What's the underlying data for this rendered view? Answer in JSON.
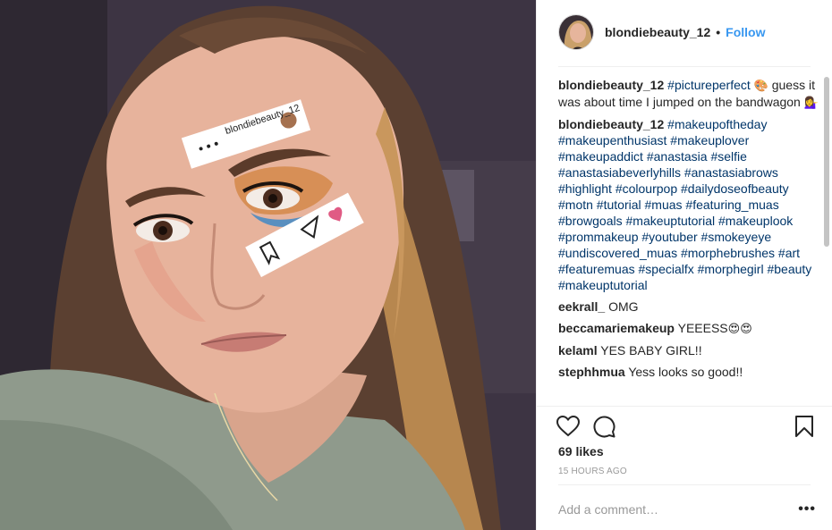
{
  "post": {
    "username": "blondiebeauty_12",
    "separator": "•",
    "follow_label": "Follow",
    "photo_alt": "",
    "sticker_username": "blondiebeauty_12"
  },
  "comments": [
    {
      "user": "blondiebeauty_12",
      "tags": "#pictureperfect",
      "text_before_emoji": "",
      "emoji": "🎨",
      "text": "guess it was about time I jumped on the bandwagon",
      "emoji2": "💁‍♀️"
    },
    {
      "user": "blondiebeauty_12",
      "tags": "#makeupoftheday #makeupenthusiast #makeuplover #makeupaddict #anastasia #selfie #anastasiabeverlyhills #anastasiabrows #highlight #colourpop #dailydoseofbeauty #motn #tutorial #muas #featuring_muas #browgoals #makeuptutorial #makeuplook #prommakeup #youtuber #smokeyeye #undiscovered_muas #morphebrushes #art #featuremuas #specialfx #morphegirl #beauty #makeuptutorial"
    },
    {
      "user": "eekrall_",
      "text": "OMG"
    },
    {
      "user": "beccamariemakeup",
      "text": "YEEESS",
      "emoji": "😍😍"
    },
    {
      "user": "kelaml",
      "text": "YES BABY GIRL!!"
    },
    {
      "user": "stephhmua",
      "text": "Yess looks so good!!"
    }
  ],
  "actions": {
    "like_icon": "heart-icon",
    "comment_icon": "speech-bubble-icon",
    "save_icon": "bookmark-icon"
  },
  "likes": "69 likes",
  "timestamp": "15 HOURS AGO",
  "add_comment": {
    "placeholder": "Add a comment…",
    "more_label": "•••"
  },
  "colors": {
    "link_blue": "#3897f0",
    "hashtag_blue": "#003569",
    "muted_gray": "#999999",
    "text": "#262626"
  }
}
